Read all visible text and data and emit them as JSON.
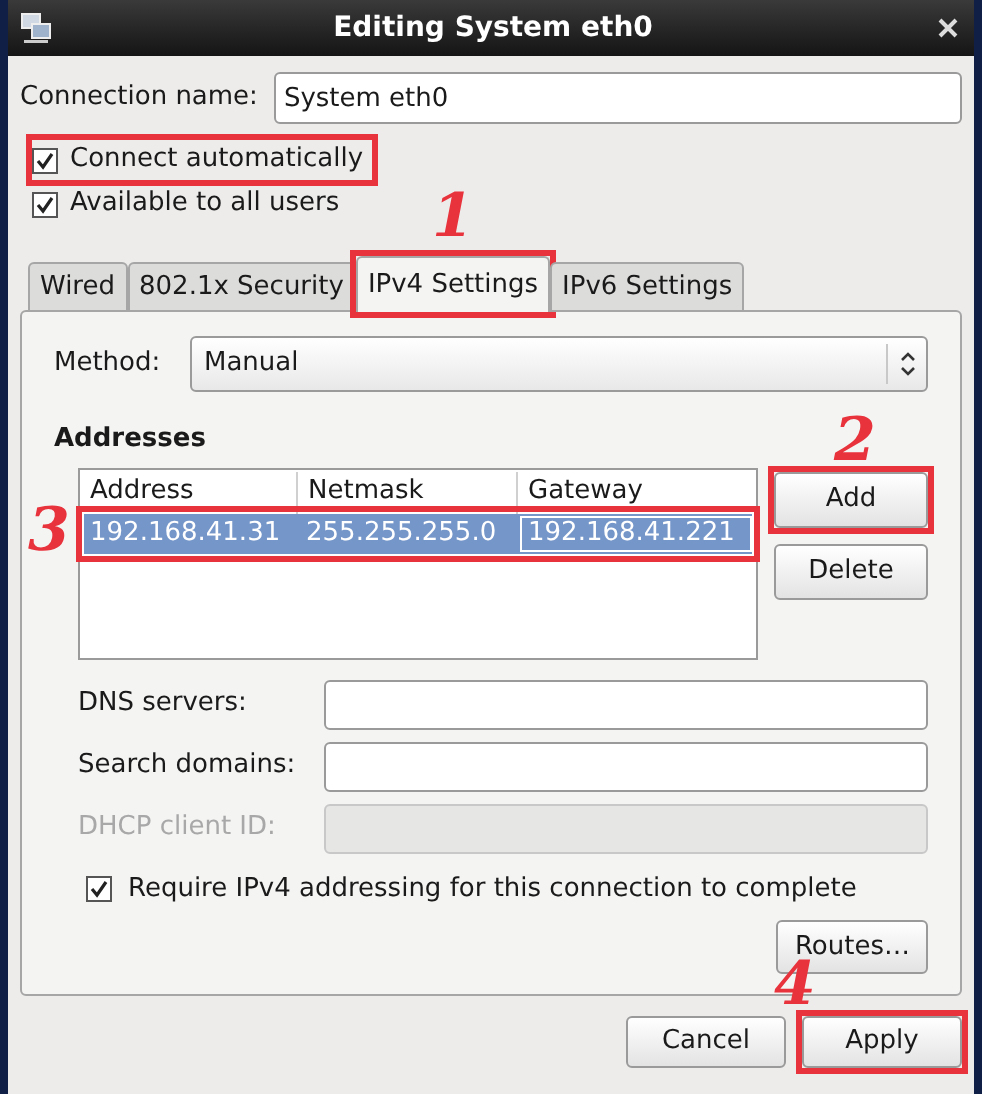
{
  "window": {
    "title": "Editing System eth0"
  },
  "connection_name": {
    "label": "Connection name:",
    "value": "System eth0"
  },
  "options": [
    {
      "label": "Connect automatically",
      "checked": true,
      "highlighted": true
    },
    {
      "label": "Available to all users",
      "checked": true,
      "highlighted": false
    }
  ],
  "tabs": [
    {
      "label": "Wired",
      "selected": false,
      "highlighted": false
    },
    {
      "label": "802.1x Security",
      "selected": false,
      "highlighted": false
    },
    {
      "label": "IPv4 Settings",
      "selected": true,
      "highlighted": true,
      "annotation": "1"
    },
    {
      "label": "IPv6 Settings",
      "selected": false,
      "highlighted": false
    }
  ],
  "method": {
    "label": "Method:",
    "value": "Manual"
  },
  "addresses": {
    "title": "Addresses",
    "columns": [
      "Address",
      "Netmask",
      "Gateway"
    ],
    "rows": [
      {
        "cells": [
          "192.168.41.31",
          "255.255.255.0",
          "192.168.41.221"
        ],
        "selected": true,
        "highlighted": true,
        "annotation": "3"
      }
    ],
    "buttons": [
      {
        "label": "Add",
        "highlighted": true,
        "annotation": "2"
      },
      {
        "label": "Delete",
        "highlighted": false
      }
    ]
  },
  "fields": [
    {
      "label": "DNS servers:",
      "disabled": false
    },
    {
      "label": "Search domains:",
      "disabled": false
    },
    {
      "label": "DHCP client ID:",
      "disabled": true
    }
  ],
  "require_ipv4": {
    "label": "Require IPv4 addressing for this connection to complete",
    "checked": true
  },
  "routes_button": {
    "label": "Routes…"
  },
  "dialog_buttons": [
    {
      "label": "Cancel",
      "highlighted": false
    },
    {
      "label": "Apply",
      "highlighted": true,
      "annotation": "4"
    }
  ]
}
